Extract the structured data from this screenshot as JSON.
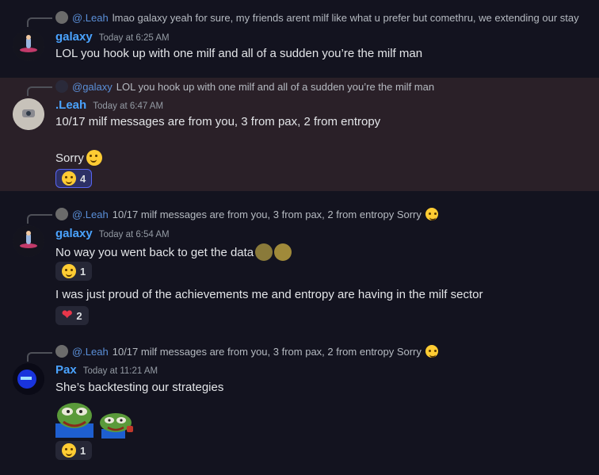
{
  "messages": [
    {
      "reply": {
        "mention": "@.Leah",
        "text": "lmao galaxy yeah for sure, my friends arent milf like what u prefer but comethru, we extending our stay"
      },
      "author": "galaxy",
      "author_color": "#4aa3ff",
      "timestamp": "Today at 6:25 AM",
      "lines": [
        "LOL you hook up with one milf and all of a sudden you’re the milf man"
      ]
    },
    {
      "reply": {
        "mention": "@galaxy",
        "text": "LOL you hook up with one milf and all of a sudden you’re the milf man"
      },
      "author": ".Leah",
      "author_color": "#4aa3ff",
      "timestamp": "Today at 6:47 AM",
      "lines": [
        "10/17 milf messages are from you, 3 from pax, 2 from entropy",
        "Sorry"
      ],
      "reactions": [
        {
          "emoji": "joy-icon",
          "count": "4"
        }
      ]
    },
    {
      "reply": {
        "mention": "@.Leah",
        "text": "10/17 milf messages are from you, 3 from pax, 2 from entropy Sorry"
      },
      "author": "galaxy",
      "author_color": "#4aa3ff",
      "timestamp": "Today at 6:54 AM",
      "lines": [
        "No way you went back to get the data",
        "I was just proud of the achievements me and entropy are having in the milf sector"
      ],
      "reactions": [
        {
          "emoji": "joy-icon",
          "count": "1"
        },
        {
          "emoji": "heart-icon",
          "count": "2"
        }
      ]
    },
    {
      "reply": {
        "mention": "@.Leah",
        "text": "10/17 milf messages are from you, 3 from pax, 2 from entropy Sorry"
      },
      "author": "Pax",
      "author_color": "#4aa3ff",
      "timestamp": "Today at 11:21 AM",
      "lines": [
        "She’s backtesting our strategies"
      ],
      "reactions": [
        {
          "emoji": "joy-icon",
          "count": "1"
        }
      ]
    }
  ],
  "colors": {
    "background": "#13131f",
    "highlight": "#2a2028",
    "mention": "#5a8fd8",
    "reaction_selected": "#5865f2"
  }
}
